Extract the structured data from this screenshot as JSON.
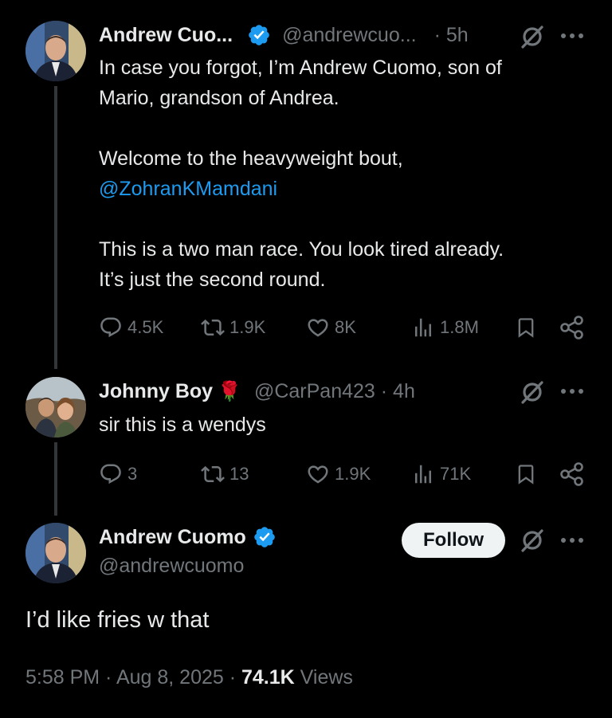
{
  "tweet1": {
    "name": "Andrew Cuo...",
    "handle": "@andrewcuo...",
    "time": "· 5h",
    "line1": "In case you forgot, I’m Andrew Cuomo, son of",
    "line2": "Mario, grandson of Andrea.",
    "line3": "Welcome to the heavyweight bout,",
    "mention": "@ZohranKMamdani",
    "line4": "This is a two man race. You look tired already.",
    "line5": "It’s just the second round.",
    "replies": "4.5K",
    "reposts": "1.9K",
    "likes": "8K",
    "views": "1.8M"
  },
  "tweet2": {
    "name": "Johnny Boy",
    "emoji": "🌹",
    "handle": "@CarPan423 · 4h",
    "text": "sir this is a wendys",
    "replies": "3",
    "reposts": "13",
    "likes": "1.9K",
    "views": "71K"
  },
  "main_tweet": {
    "name": "Andrew Cuomo",
    "handle": "@andrewcuomo",
    "follow_label": "Follow",
    "text": "I’d like fries w that",
    "timestamp": "5:58 PM · Aug 8, 2025 · ",
    "views_count": "74.1K",
    "views_label": " Views"
  },
  "colors": {
    "background": "#000000",
    "text": "#e7e9ea",
    "muted": "#71767b",
    "link": "#1d9bf0",
    "verified": "#1d9bf0"
  },
  "icons": [
    "verified-badge-icon",
    "grok-icon",
    "more-icon",
    "reply-icon",
    "repost-icon",
    "like-icon",
    "views-icon",
    "bookmark-icon",
    "share-icon"
  ]
}
